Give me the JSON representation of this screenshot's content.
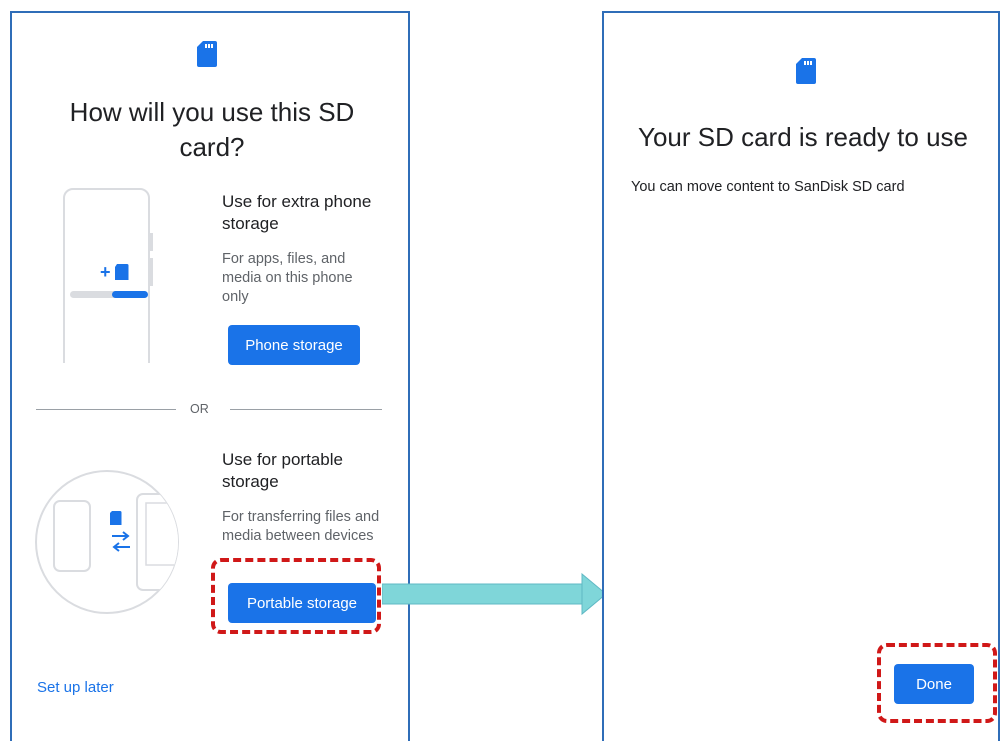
{
  "left": {
    "title": "How will you use this SD card?",
    "phone_option": {
      "title": "Use for extra phone storage",
      "description": "For apps, files, and media on this phone only",
      "button": "Phone storage"
    },
    "divider_label": "OR",
    "portable_option": {
      "title": "Use for portable storage",
      "description": "For transferring files and media between devices",
      "button": "Portable storage"
    },
    "footer_link": "Set up later"
  },
  "right": {
    "title": "Your SD card is ready to use",
    "message": "You can move content to SanDisk SD card",
    "button": "Done"
  },
  "colors": {
    "accent": "#1a73e8",
    "frame": "#2f6db8",
    "highlight": "#d01818",
    "arrow": "#7fd6d9"
  },
  "icons": [
    "sd-card-icon",
    "phone-storage-illustration",
    "portable-storage-illustration",
    "transfer-arrows-icon",
    "arrow-right"
  ]
}
